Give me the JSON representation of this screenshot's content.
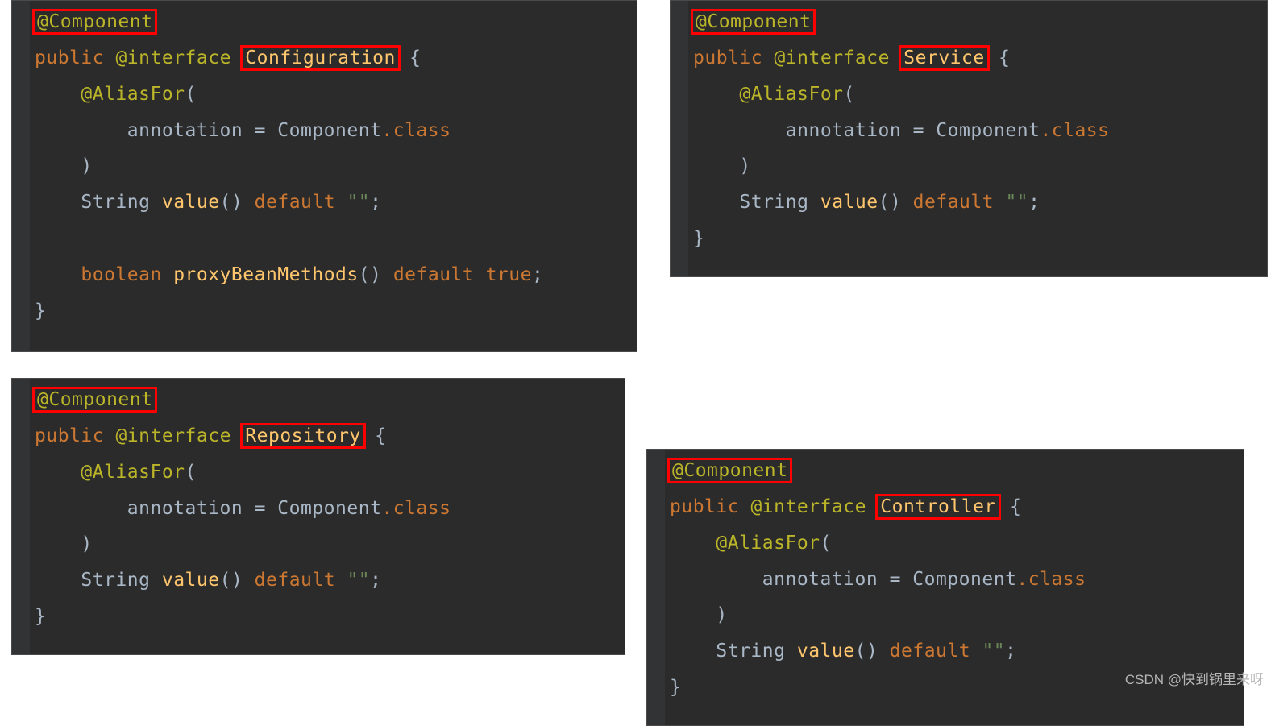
{
  "panels": {
    "configuration": {
      "component_annotation": "@Component",
      "public_kw": "public",
      "interface_kw": "@interface",
      "name": "Configuration",
      "brace_open": " {",
      "aliasfor": "@AliasFor",
      "aliasfor_open": "(",
      "annotation_assign_pre": "annotation = ",
      "annotation_component": "Component",
      "dot_class": ".class",
      "aliasfor_close": ")",
      "string_type": "String",
      "value_name": "value",
      "value_paren": "()",
      "default_kw": "default",
      "empty_str": "\"\"",
      "semi": ";",
      "bool_kw": "boolean",
      "proxy_name": "proxyBeanMethods",
      "proxy_paren": "()",
      "true_kw": "true",
      "brace_close": "}"
    },
    "service": {
      "component_annotation": "@Component",
      "public_kw": "public",
      "interface_kw": "@interface",
      "name": "Service",
      "brace_open": " {",
      "aliasfor": "@AliasFor",
      "aliasfor_open": "(",
      "annotation_assign_pre": "annotation = ",
      "annotation_component": "Component",
      "dot_class": ".class",
      "aliasfor_close": ")",
      "string_type": "String",
      "value_name": "value",
      "value_paren": "()",
      "default_kw": "default",
      "empty_str": "\"\"",
      "semi": ";",
      "brace_close": "}"
    },
    "repository": {
      "component_annotation": "@Component",
      "public_kw": "public",
      "interface_kw": "@interface",
      "name": "Repository",
      "brace_open": " {",
      "aliasfor": "@AliasFor",
      "aliasfor_open": "(",
      "annotation_assign_pre": "annotation = ",
      "annotation_component": "Component",
      "dot_class": ".class",
      "aliasfor_close": ")",
      "string_type": "String",
      "value_name": "value",
      "value_paren": "()",
      "default_kw": "default",
      "empty_str": "\"\"",
      "semi": ";",
      "brace_close": "}"
    },
    "controller": {
      "component_annotation": "@Component",
      "public_kw": "public",
      "interface_kw": "@interface",
      "name": "Controller",
      "brace_open": " {",
      "aliasfor": "@AliasFor",
      "aliasfor_open": "(",
      "annotation_assign_pre": "annotation = ",
      "annotation_component": "Component",
      "dot_class": ".class",
      "aliasfor_close": ")",
      "string_type": "String",
      "value_name": "value",
      "value_paren": "()",
      "default_kw": "default",
      "empty_str": "\"\"",
      "semi": ";",
      "brace_close": "}"
    }
  },
  "watermark": "CSDN @快到锅里来呀"
}
